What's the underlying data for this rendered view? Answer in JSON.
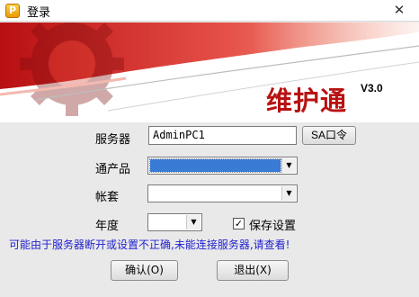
{
  "window": {
    "title": "登录",
    "close_glyph": "✕"
  },
  "banner": {
    "brand_title": "维护通",
    "version": "V3.0"
  },
  "form": {
    "server_label": "服务器",
    "server_value": "AdminPC1",
    "sa_button_label": "SA口令",
    "product_label": "通产品",
    "product_value": "",
    "account_label": "帐套",
    "account_value": "",
    "year_label": "年度",
    "year_value": "",
    "save_settings_label": "保存设置",
    "save_settings_checked": true,
    "checkbox_glyph": "✓",
    "dropdown_glyph": "▼"
  },
  "status": {
    "warning_text": "可能由于服务器断开或设置不正确,未能连接服务器,请查看!"
  },
  "buttons": {
    "ok_label": "确认(O)",
    "exit_label": "退出(X)"
  },
  "colors": {
    "accent_red": "#c8141a",
    "warning_blue": "#1f1fd0",
    "selection_blue": "#3a7bd5"
  }
}
